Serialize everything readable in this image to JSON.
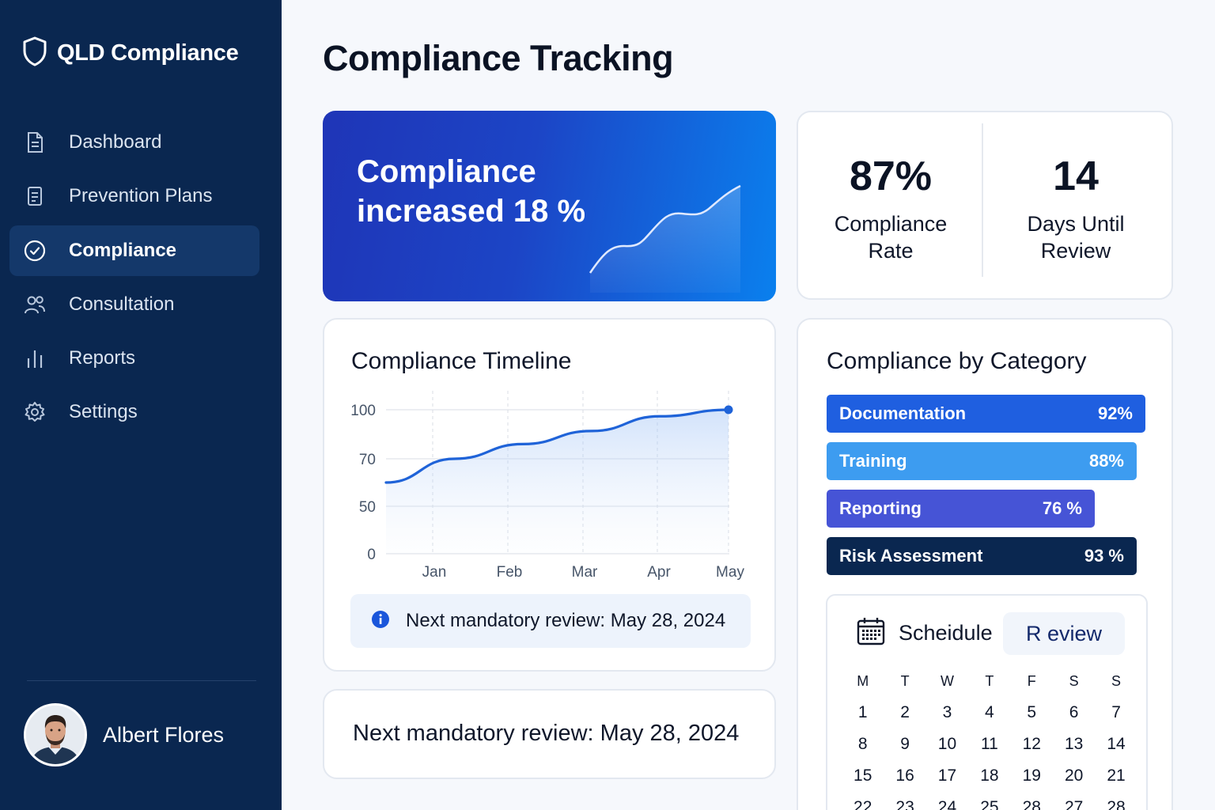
{
  "app": {
    "title": "QLD Compliance"
  },
  "sidebar": {
    "items": [
      {
        "label": "Dashboard",
        "icon": "document-icon",
        "active": false
      },
      {
        "label": "Prevention Plans",
        "icon": "clipboard-icon",
        "active": false
      },
      {
        "label": "Compliance",
        "icon": "check-circle-icon",
        "active": true
      },
      {
        "label": "Consultation",
        "icon": "users-icon",
        "active": false
      },
      {
        "label": "Reports",
        "icon": "bar-chart-icon",
        "active": false
      },
      {
        "label": "Settings",
        "icon": "gear-icon",
        "active": false
      }
    ],
    "user": {
      "name": "Albert Flores"
    }
  },
  "page": {
    "title": "Compliance Tracking"
  },
  "hero": {
    "text": "Compliance increased 18 %"
  },
  "stats": [
    {
      "value": "87%",
      "label": "Compliance Rate"
    },
    {
      "value": "14",
      "label": "Days Until Review"
    }
  ],
  "timeline": {
    "title": "Compliance Timeline",
    "info": "Next mandatory review: May 28, 2024"
  },
  "chart_data": {
    "type": "line",
    "x": [
      "Jan",
      "Feb",
      "Mar",
      "Apr",
      "May"
    ],
    "yticks": [
      0,
      50,
      70,
      100
    ],
    "series": [
      {
        "values": [
          60,
          70,
          79,
          87,
          96,
          100
        ]
      }
    ],
    "title": "Compliance Timeline",
    "xlabel": "",
    "ylabel": "",
    "ylim": [
      0,
      100
    ],
    "grid": true
  },
  "next_review": {
    "text": "Next mandatory review: May 28, 2024"
  },
  "category": {
    "title": "Compliance by Category",
    "bars": [
      {
        "label": "Documentation",
        "pct_label": "92%",
        "value": 92,
        "color": "#1f5fe0"
      },
      {
        "label": "Training",
        "pct_label": "88%",
        "value": 88,
        "color": "#3d9cf0"
      },
      {
        "label": "Reporting",
        "pct_label": "76 %",
        "value": 76,
        "color": "#4654d6"
      },
      {
        "label": "Risk Assessment",
        "pct_label": "93 %",
        "value": 93,
        "color": "#0a2750"
      }
    ]
  },
  "schedule": {
    "title": "Scheidule",
    "button": "R eview",
    "weekdays": [
      "M",
      "T",
      "W",
      "T",
      "F",
      "S",
      "S"
    ],
    "weeks": [
      [
        "1",
        "2",
        "3",
        "4",
        "5",
        "6",
        "7"
      ],
      [
        "8",
        "9",
        "10",
        "11",
        "12",
        "13",
        "14"
      ],
      [
        "15",
        "16",
        "17",
        "18",
        "19",
        "20",
        "21"
      ],
      [
        "22",
        "23",
        "24",
        "25",
        "28",
        "27",
        "28"
      ]
    ]
  },
  "colors": {
    "sidebar": "#0a2750",
    "accent": "#1f5fe0",
    "background": "#f6f8fc"
  }
}
